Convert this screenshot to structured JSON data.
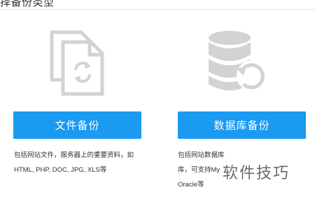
{
  "header": {
    "title": "择备份类型"
  },
  "options": {
    "file": {
      "button_label": "文件备份",
      "desc_line1": "包括网站文件，服务器上的重要资料，如",
      "desc_line2": "HTML, PHP, DOC, JPG, XLS等",
      "icon": "file-sync-icon"
    },
    "database": {
      "button_label": "数据库备份",
      "desc_line1": "包括网站数据库",
      "desc_line2": "库，可支持My",
      "desc_line3": "Oracle等",
      "icon": "database-restore-icon"
    }
  },
  "watermark": {
    "text": "软件技巧"
  },
  "colors": {
    "accent": "#1a9af0",
    "icon_gray": "#d3d3d3",
    "text": "#333333"
  }
}
